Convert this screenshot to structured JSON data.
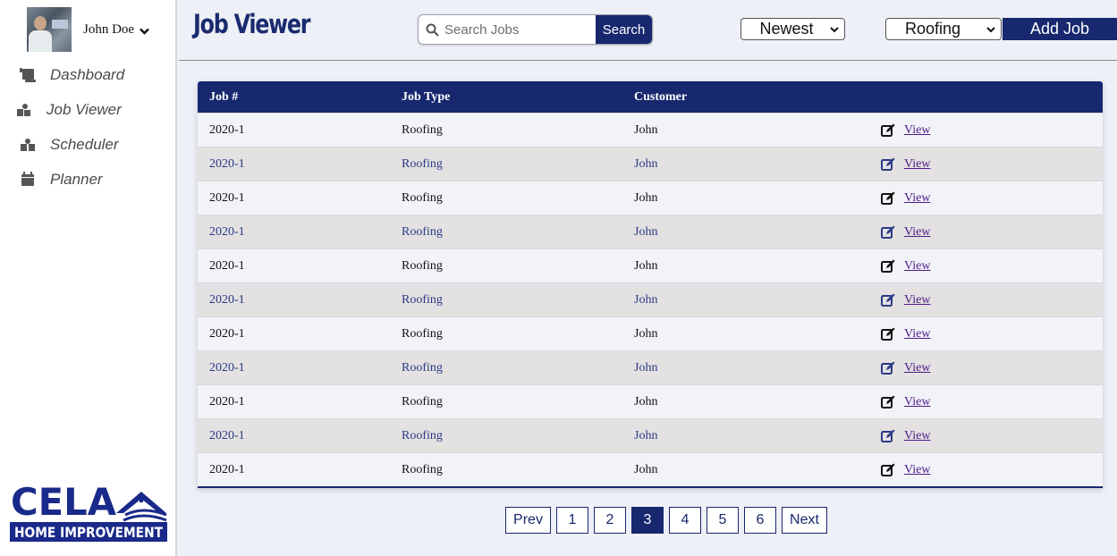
{
  "user": {
    "name": "John Doe"
  },
  "nav": {
    "items": [
      {
        "label": "Dashboard",
        "icon": "dashboard-icon"
      },
      {
        "label": "Job Viewer",
        "icon": "job-viewer-icon"
      },
      {
        "label": "Scheduler",
        "icon": "scheduler-icon"
      },
      {
        "label": "Planner",
        "icon": "calendar-icon"
      }
    ]
  },
  "logo": {
    "line1": "CELA",
    "line2": "HOME IMPROVEMENT"
  },
  "header": {
    "title": "Job Viewer",
    "search_placeholder": "Search Jobs",
    "search_label": "Search",
    "sort_value": "Newest",
    "type_value": "Roofing",
    "add_label": "Add Job"
  },
  "table": {
    "columns": [
      "Job #",
      "Job Type",
      "Customer"
    ],
    "view_label": "View",
    "rows": [
      {
        "job": "2020-1",
        "type": "Roofing",
        "customer": "John"
      },
      {
        "job": "2020-1",
        "type": "Roofing",
        "customer": "John"
      },
      {
        "job": "2020-1",
        "type": "Roofing",
        "customer": "John"
      },
      {
        "job": "2020-1",
        "type": "Roofing",
        "customer": "John"
      },
      {
        "job": "2020-1",
        "type": "Roofing",
        "customer": "John"
      },
      {
        "job": "2020-1",
        "type": "Roofing",
        "customer": "John"
      },
      {
        "job": "2020-1",
        "type": "Roofing",
        "customer": "John"
      },
      {
        "job": "2020-1",
        "type": "Roofing",
        "customer": "John"
      },
      {
        "job": "2020-1",
        "type": "Roofing",
        "customer": "John"
      },
      {
        "job": "2020-1",
        "type": "Roofing",
        "customer": "John"
      },
      {
        "job": "2020-1",
        "type": "Roofing",
        "customer": "John"
      }
    ]
  },
  "pagination": {
    "prev": "Prev",
    "next": "Next",
    "pages": [
      "1",
      "2",
      "3",
      "4",
      "5",
      "6"
    ],
    "current": "3"
  },
  "colors": {
    "brand": "#17286e",
    "row_alt": "#e3e1e1",
    "link": "#4b1a86"
  }
}
